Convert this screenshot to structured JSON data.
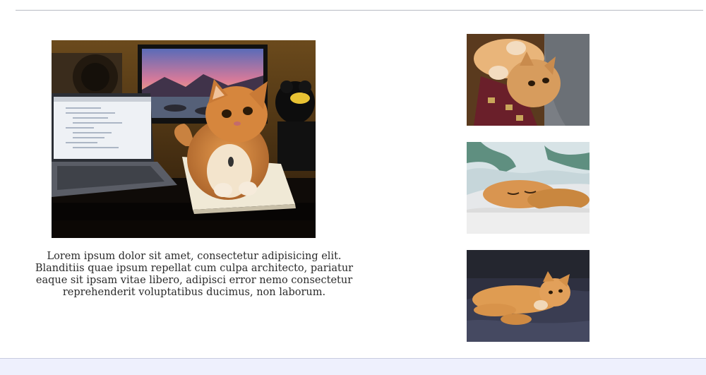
{
  "caption": {
    "text": "Lorem ipsum dolor sit amet, consectetur adipisicing elit. Blanditiis quae ipsum repellat cum culpa architecto, pariatur eaque sit ipsam vitae libero, adipisci error nemo consectetur reprehenderit voluptatibus ducimus, non laborum."
  },
  "images": {
    "main": {
      "icon": "cat-desk-photo"
    },
    "thumbs": [
      {
        "icon": "cat-peeking-photo"
      },
      {
        "icon": "cat-under-blanket-photo"
      },
      {
        "icon": "cat-on-couch-photo"
      }
    ]
  },
  "colors": {
    "footer_bar": "#eef0fd",
    "rule": "#b8bcc4"
  }
}
